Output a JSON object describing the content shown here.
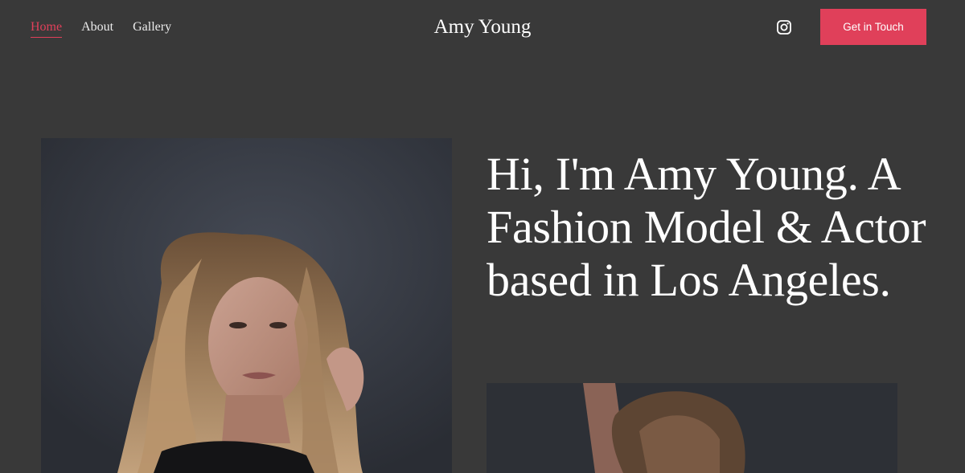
{
  "nav": {
    "items": [
      {
        "label": "Home",
        "active": true
      },
      {
        "label": "About",
        "active": false
      },
      {
        "label": "Gallery",
        "active": false
      }
    ]
  },
  "brand": {
    "name": "Amy Young"
  },
  "header": {
    "instagram_icon": "instagram-icon",
    "cta_label": "Get in Touch"
  },
  "hero": {
    "headline": "Hi, I'm Amy Young. A Fashion Model & Actor based in Los Angeles."
  },
  "colors": {
    "background": "#393939",
    "accent": "#e0405a",
    "text": "#ffffff"
  }
}
